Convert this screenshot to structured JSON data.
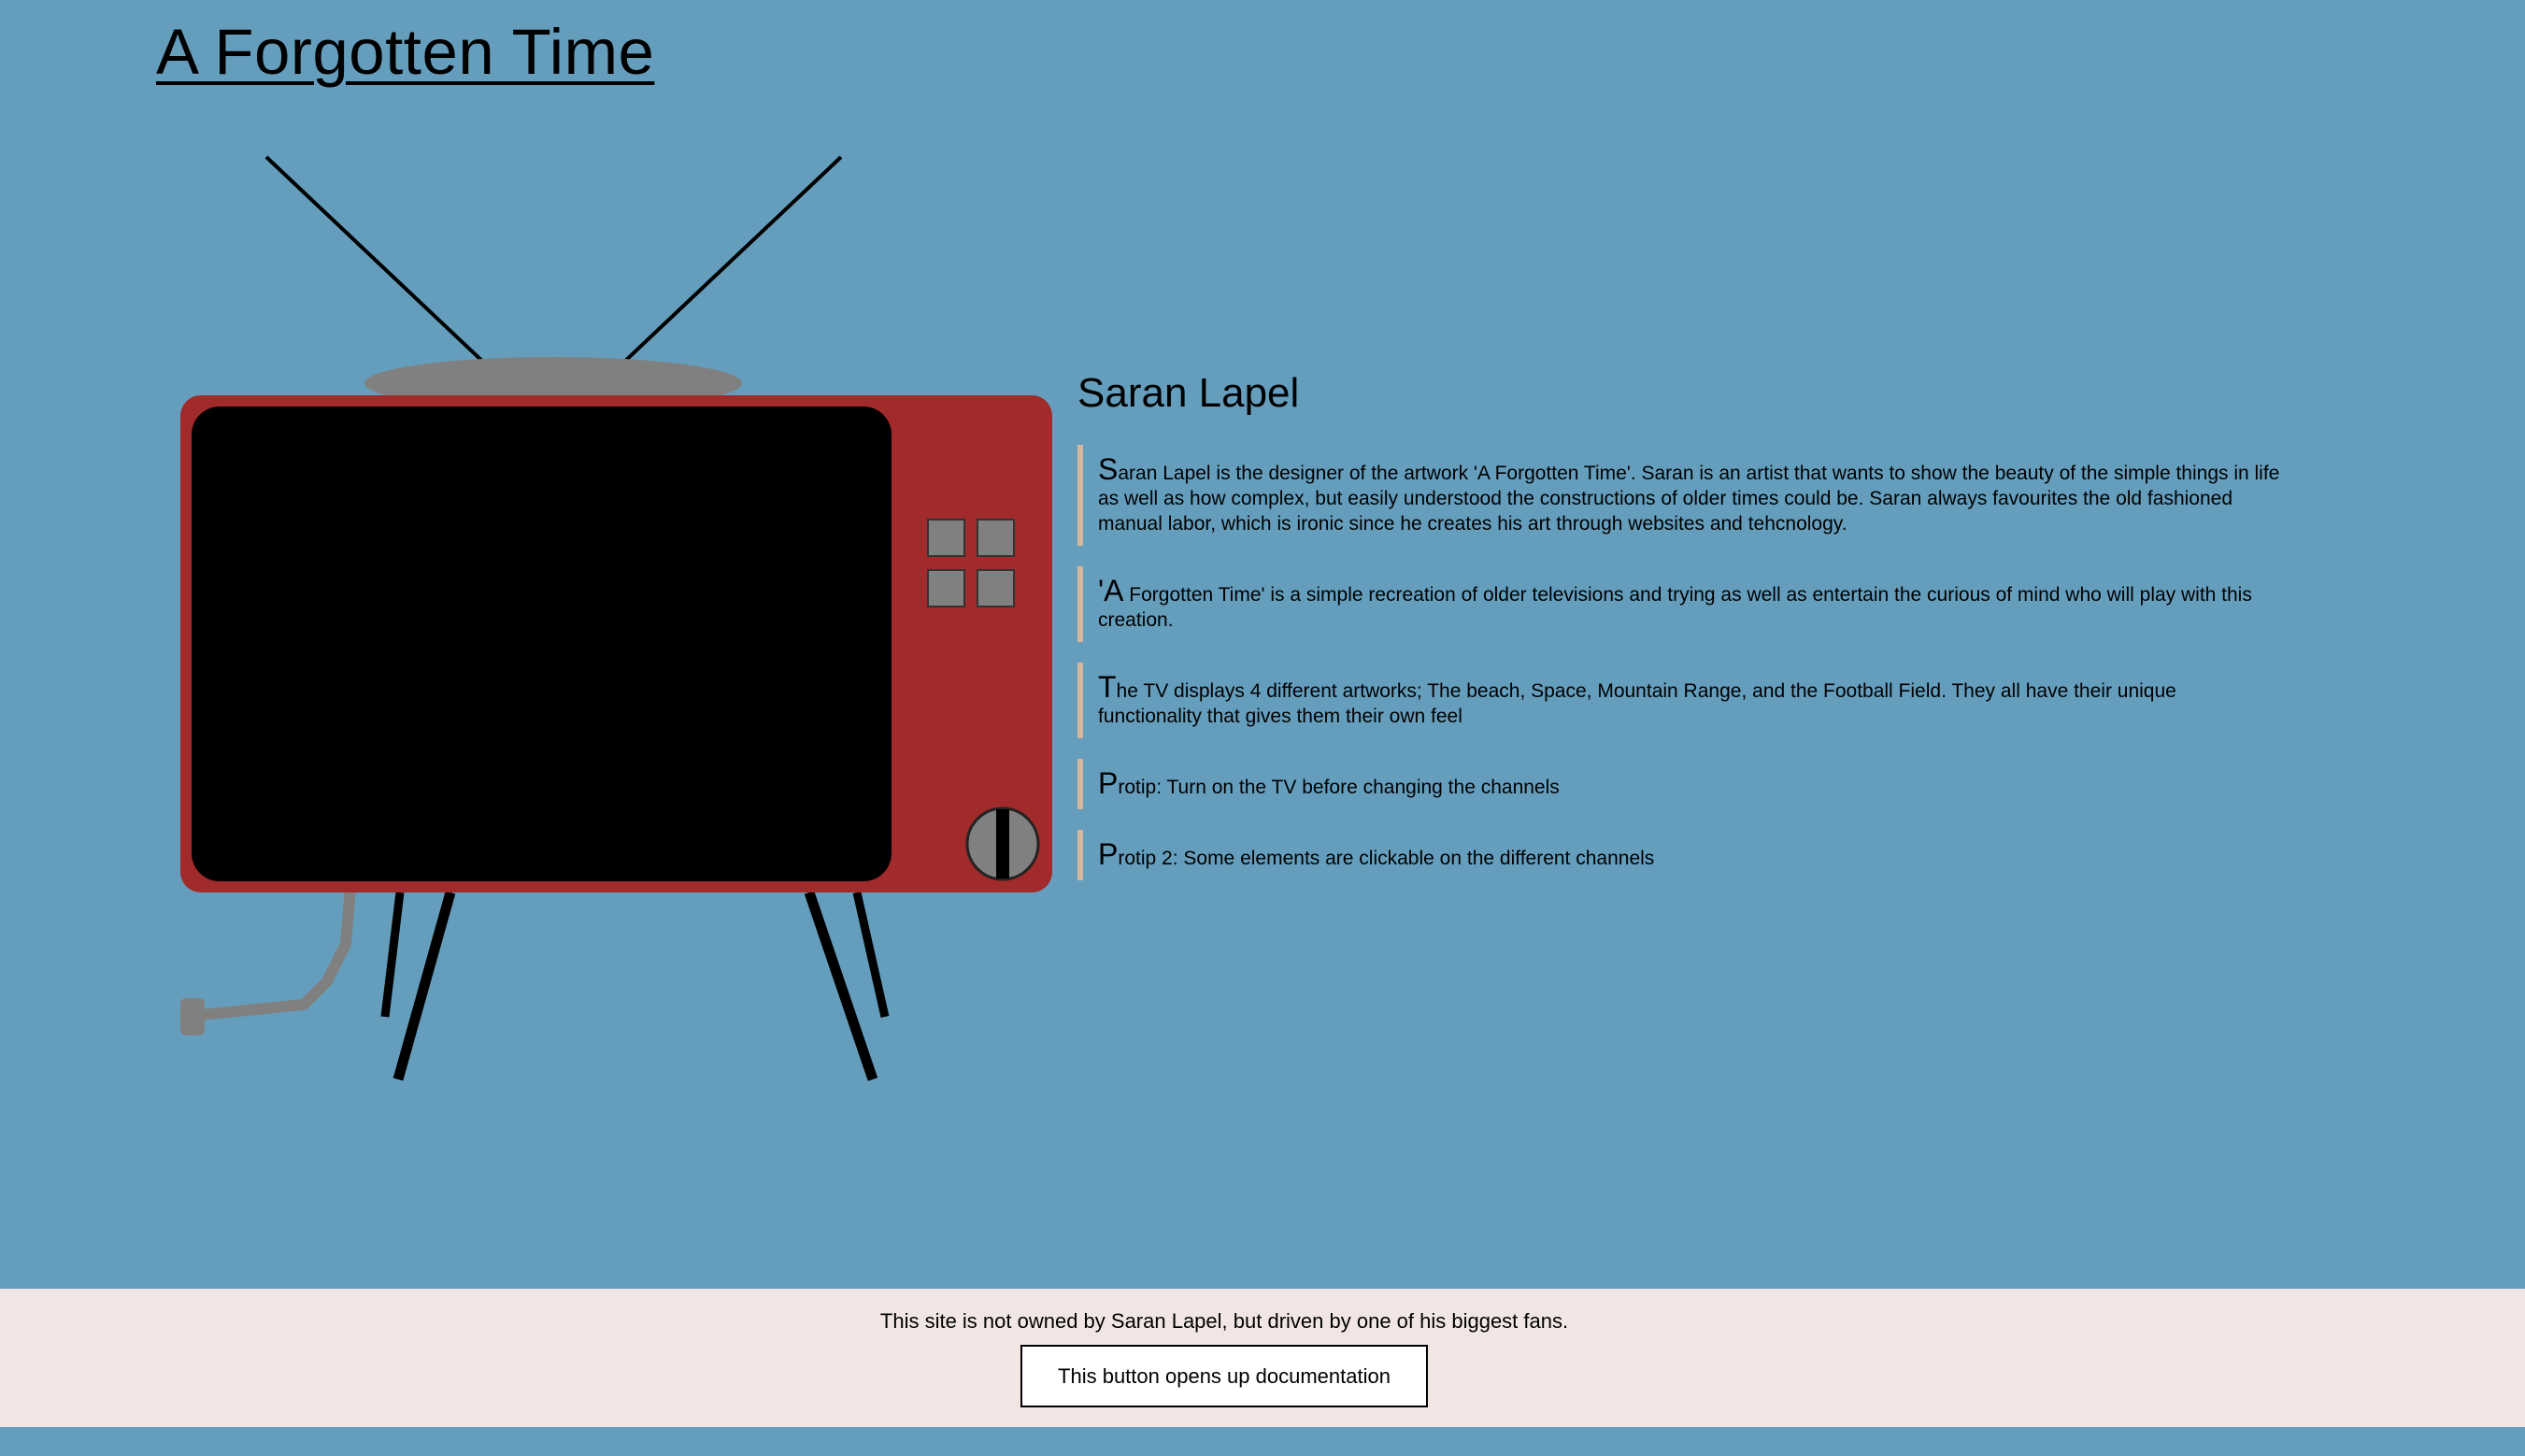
{
  "page": {
    "title": "A Forgotten Time"
  },
  "colors": {
    "background": "#659ebd",
    "tv_body": "#a12a2a",
    "tv_screen": "#000000",
    "tv_parts": "#808080",
    "bio_border": "#d6b79c",
    "footer_background": "#f2e6e5"
  },
  "tv": {
    "channel_buttons": [
      "channel-button-1",
      "channel-button-2",
      "channel-button-3",
      "channel-button-4"
    ],
    "power_knob_icon": "power-knob-icon"
  },
  "info": {
    "artist_name": "Saran Lapel",
    "paragraphs": [
      {
        "initial": "S",
        "rest": "aran Lapel is the designer of the artwork 'A Forgotten Time'. Saran is an artist that wants to show the beauty of the simple things in life as well as how complex, but easily understood the constructions of older times could be. Saran always favourites the old fashioned manual labor, which is ironic since he creates his art through websites and tehcnology."
      },
      {
        "initial": "'A",
        "rest": " Forgotten Time' is a simple recreation of older televisions and trying as well as entertain the curious of mind who will play with this creation."
      },
      {
        "initial": "T",
        "rest": "he TV displays 4 different artworks; The beach, Space, Mountain Range, and the Football Field. They all have their unique functionality that gives them their own feel"
      },
      {
        "initial": "P",
        "rest": "rotip: Turn on the TV before changing the channels"
      },
      {
        "initial": "P",
        "rest": "rotip 2: Some elements are clickable on the different channels"
      }
    ]
  },
  "footer": {
    "text": "This site is not owned by Saran Lapel, but driven by one of his biggest fans.",
    "button_label": "This button opens up documentation"
  }
}
